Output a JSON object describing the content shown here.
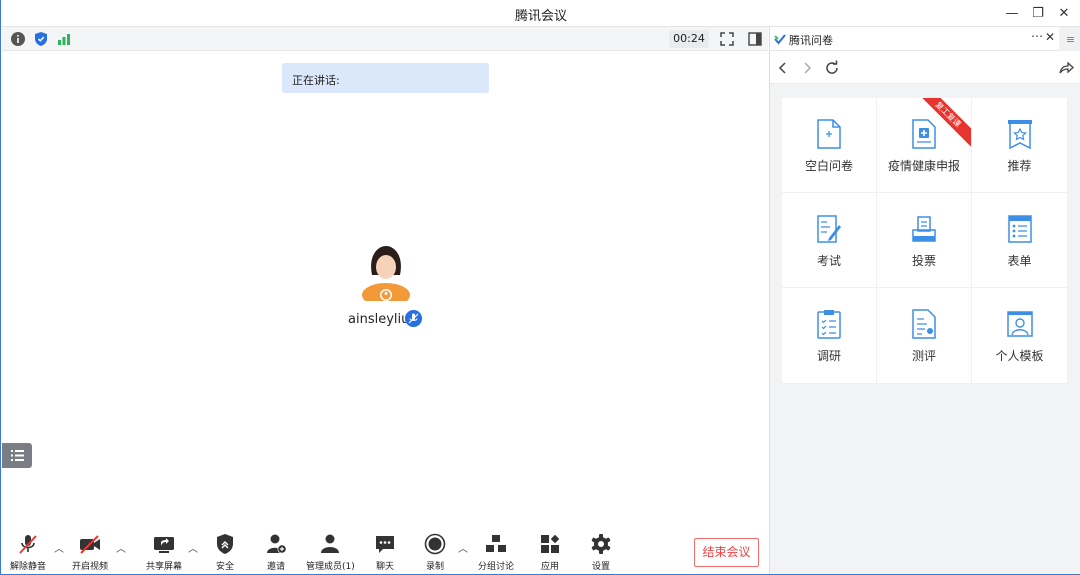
{
  "window": {
    "title": "腾讯会议"
  },
  "meeting": {
    "timer": "00:24",
    "speaking_label": "正在讲话:",
    "participant_name": "ainsleyliu"
  },
  "toolbar": {
    "unmute_label": "解除静音",
    "start_video_label": "开启视频",
    "share_screen_label": "共享屏幕",
    "security_label": "安全",
    "invite_label": "邀请",
    "manage_members_label": "管理成员(1)",
    "chat_label": "聊天",
    "record_label": "录制",
    "breakout_label": "分组讨论",
    "apps_label": "应用",
    "settings_label": "设置",
    "end_meeting_label": "结束会议"
  },
  "panel": {
    "tab_title": "腾讯问卷",
    "items": [
      {
        "label": "空白问卷",
        "icon": "blank-doc-icon"
      },
      {
        "label": "疫情健康申报",
        "icon": "health-report-icon",
        "ribbon": "复工复课"
      },
      {
        "label": "推荐",
        "icon": "recommend-icon"
      },
      {
        "label": "考试",
        "icon": "exam-icon"
      },
      {
        "label": "投票",
        "icon": "vote-icon"
      },
      {
        "label": "表单",
        "icon": "form-icon"
      },
      {
        "label": "调研",
        "icon": "research-icon"
      },
      {
        "label": "测评",
        "icon": "assessment-icon"
      },
      {
        "label": "个人模板",
        "icon": "personal-template-icon"
      }
    ]
  },
  "colors": {
    "accent": "#2a6fe0",
    "icon_blue": "#3d8fe6",
    "end_red": "#e84545"
  }
}
